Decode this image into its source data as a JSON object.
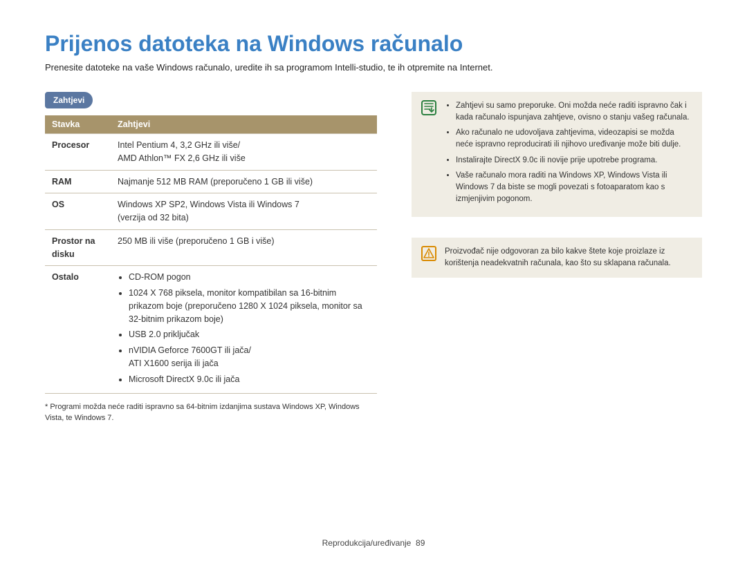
{
  "title": "Prijenos datoteka na Windows računalo",
  "intro": "Prenesite datoteke na vaše Windows računalo, uredite ih sa programom Intelli-studio, te ih otpremite na Internet.",
  "section_tag": "Zahtjevi",
  "table": {
    "headers": {
      "item": "Stavka",
      "req": "Zahtjevi"
    },
    "rows": {
      "procesor": {
        "label": "Procesor",
        "value_line1": "Intel Pentium 4, 3,2 GHz ili više/",
        "value_line2": "AMD Athlon™ FX 2,6 GHz ili više"
      },
      "ram": {
        "label": "RAM",
        "value": "Najmanje 512 MB RAM (preporučeno 1 GB ili više)"
      },
      "os": {
        "label": "OS",
        "value_line1": "Windows XP SP2, Windows Vista ili Windows 7",
        "value_line2": "(verzija od 32 bita)"
      },
      "disk": {
        "label": "Prostor na disku",
        "value": "250 MB ili više (preporučeno 1 GB i više)"
      },
      "ostalo": {
        "label": "Ostalo",
        "items": {
          "i1": "CD-ROM pogon",
          "i2": "1024 X 768 piksela, monitor kompatibilan sa 16-bitnim prikazom boje (preporučeno 1280 X 1024 piksela, monitor sa 32-bitnim prikazom boje)",
          "i3": "USB 2.0 priključak",
          "i4_a": "nVIDIA Geforce 7600GT ili jača/",
          "i4_b": "ATI X1600 serija ili jača",
          "i5": "Microsoft DirectX 9.0c ili jača"
        }
      }
    }
  },
  "footnote": "* Programi možda neće raditi ispravno sa 64-bitnim izdanjima sustava Windows XP, Windows Vista, te Windows 7.",
  "note_box": {
    "items": {
      "n1": "Zahtjevi su samo preporuke. Oni možda neće raditi ispravno čak i kada računalo ispunjava zahtjeve, ovisno o stanju vašeg računala.",
      "n2": "Ako računalo ne udovoljava zahtjevima, videozapisi se možda neće ispravno reproducirati ili njihovo uređivanje može biti dulje.",
      "n3": "Instalirajte DirectX 9.0c ili novije prije upotrebe programa.",
      "n4": "Vaše računalo mora raditi na Windows XP, Windows Vista ili Windows 7 da biste se mogli povezati s fotoaparatom kao s izmjenjivim pogonom."
    }
  },
  "warn_box": {
    "text": "Proizvođač nije odgovoran za bilo kakve štete koje proizlaze iz korištenja neadekvatnih računala, kao što su sklapana računala."
  },
  "footer": {
    "section": "Reprodukcija/uređivanje",
    "page": "89"
  }
}
